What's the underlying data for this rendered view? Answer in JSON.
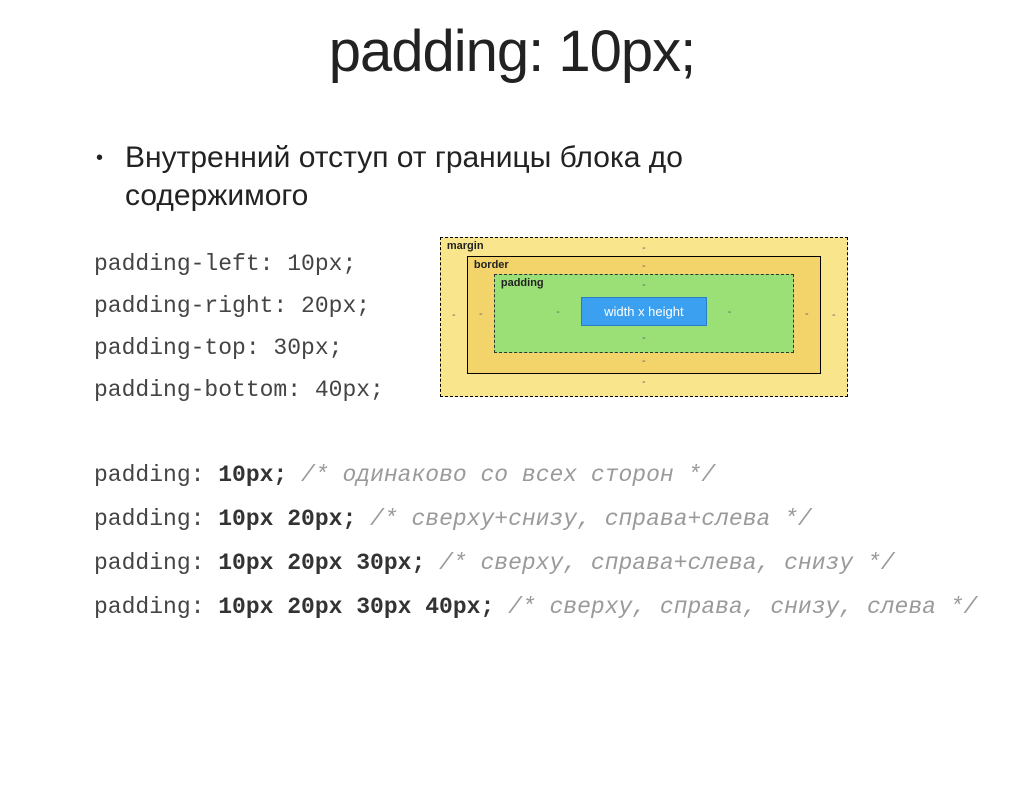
{
  "title": "padding: 10px;",
  "bullet": "Внутренний отступ от границы блока до содержимого",
  "code": {
    "l1": "padding-left: 10px;",
    "l2": "padding-right: 20px;",
    "l3": "padding-top: 30px;",
    "l4": "padding-bottom: 40px;"
  },
  "boxmodel": {
    "margin": "margin",
    "border": "border",
    "padding": "padding",
    "content": "width x height",
    "dash": "-"
  },
  "shorthand": [
    {
      "prop": "padding:",
      "val": " 10px;",
      "comment": " /* одинаково со всех сторон */"
    },
    {
      "prop": "padding:",
      "val": " 10px 20px;",
      "comment": " /* сверху+снизу, справа+слева */"
    },
    {
      "prop": "padding:",
      "val": " 10px 20px 30px;",
      "comment": " /* сверху, справа+слева, снизу */"
    },
    {
      "prop": "padding:",
      "val": " 10px 20px 30px 40px;",
      "comment": " /* сверху, справа, снизу, слева */"
    }
  ]
}
